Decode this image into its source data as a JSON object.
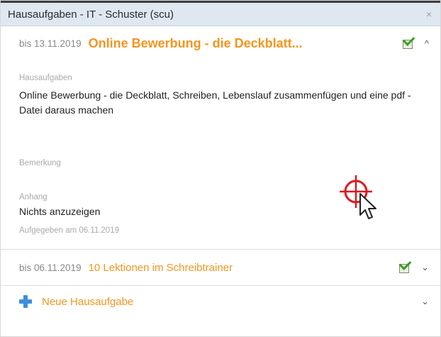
{
  "window": {
    "title": "Hausaufgaben - IT - Schuster (scu)",
    "close_glyph": "×"
  },
  "items": [
    {
      "due": "bis 13.11.2019",
      "subject": "Online Bewerbung - die Deckblatt...",
      "status_icon": "checked-notepad-icon",
      "toggle_glyph": "^",
      "expanded": true,
      "label_homework": "Hausaufgaben",
      "homework_text": "Online Bewerbung - die Deckblatt, Schreiben, Lebenslauf zusammenfügen und eine pdf - Datei daraus machen",
      "label_remark": "Bemerkung",
      "remark_text": "",
      "label_attachment": "Anhang",
      "attachment_text": "Nichts anzuzeigen",
      "assigned": "Aufgegeben am 06.11.2019"
    },
    {
      "due": "bis 06.11.2019",
      "subject": "10 Lektionen im Schreibtrainer",
      "status_icon": "checked-notepad-icon",
      "toggle_glyph": "⌄",
      "expanded": false
    }
  ],
  "new_homework": {
    "label": "Neue Hausaufgabe",
    "icon": "plus-icon",
    "toggle_glyph": "⌄"
  },
  "colors": {
    "accent": "#f7941d",
    "title_bar": "#dfe8f1",
    "check_green": "#3a9d23",
    "plus_blue": "#3d8edb",
    "target_red": "#e0161e"
  }
}
